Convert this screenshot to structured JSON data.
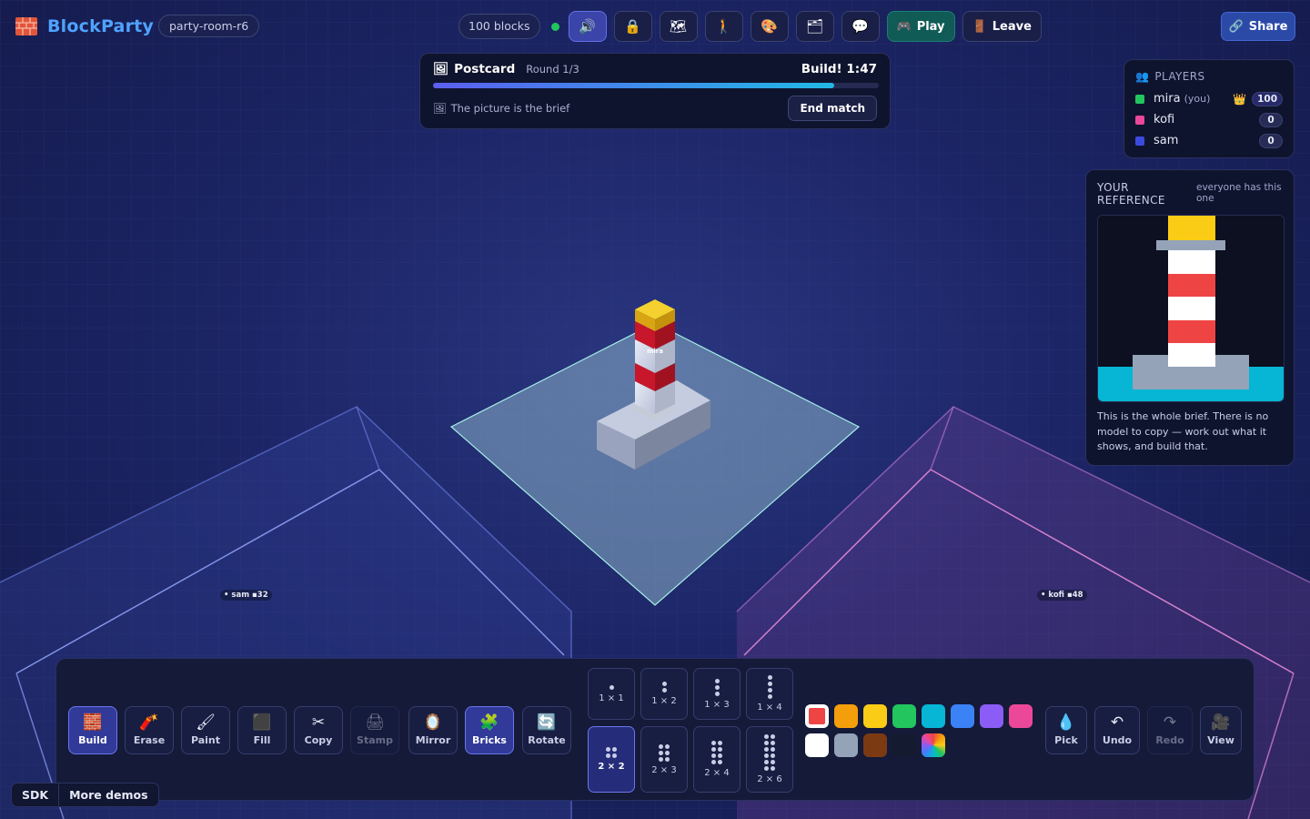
{
  "app": {
    "brand": "BlockParty",
    "room": "party-room-r6"
  },
  "topbar": {
    "blocks": "100 blocks",
    "buttons": [
      {
        "name": "sound-toggle-button",
        "icon": "🔊",
        "active": true
      },
      {
        "name": "lock-button",
        "icon": "🔒"
      },
      {
        "name": "map-button",
        "icon": "🗺"
      },
      {
        "name": "walk-button",
        "icon": "🚶"
      },
      {
        "name": "palette-button",
        "icon": "🎨"
      },
      {
        "name": "gallery-button",
        "icon": "🗂"
      },
      {
        "name": "chat-button",
        "icon": "💬"
      }
    ],
    "play_icon": "🎮",
    "play_label": "Play",
    "leave_icon": "🚪",
    "leave_label": "Leave",
    "share_icon": "🔗",
    "share_label": "Share"
  },
  "round": {
    "icon": "🖼",
    "title": "Postcard",
    "round_label": "Round 1/3",
    "timer": "Build! 1:47",
    "progress": 0.9,
    "hint_icon": "🖼",
    "hint": "The picture is the brief",
    "end_label": "End match"
  },
  "players": {
    "heading_icon": "👥",
    "heading": "PLAYERS",
    "list": [
      {
        "name": "mira",
        "you": "(you)",
        "crown": "👑",
        "score": "100",
        "color": "#22c55e"
      },
      {
        "name": "kofi",
        "score": "0",
        "color": "#ec4899"
      },
      {
        "name": "sam",
        "score": "0",
        "color": "#3b4be0"
      }
    ]
  },
  "reference": {
    "heading": "YOUR REFERENCE",
    "sub": "everyone has this one",
    "text": "This is the whole brief. There is no model to copy — work out what it shows, and build that."
  },
  "scene": {
    "tag_mira": "mira",
    "tag_sam": "sam",
    "tag_sam_count": "32",
    "tag_kofi": "kofi",
    "tag_kofi_count": "48"
  },
  "toolbar": {
    "tools": [
      {
        "name": "build-tool",
        "icon": "🧱",
        "label": "Build",
        "active": true
      },
      {
        "name": "erase-tool",
        "icon": "🧨",
        "label": "Erase"
      },
      {
        "name": "paint-tool",
        "icon": "🖌",
        "label": "Paint"
      },
      {
        "name": "fill-tool",
        "icon": "⬛",
        "label": "Fill"
      },
      {
        "name": "copy-tool",
        "icon": "✂",
        "label": "Copy"
      },
      {
        "name": "stamp-tool",
        "icon": "🖨",
        "label": "Stamp",
        "disabled": true
      },
      {
        "name": "mirror-tool",
        "icon": "🪞",
        "label": "Mirror"
      },
      {
        "name": "bricks-tool",
        "icon": "🧩",
        "label": "Bricks",
        "active": true
      },
      {
        "name": "rotate-tool",
        "icon": "🔄",
        "label": "Rotate"
      }
    ],
    "bricks": [
      {
        "label": "1 × 1",
        "cols": 1,
        "rows": 1
      },
      {
        "label": "1 × 2",
        "cols": 1,
        "rows": 2
      },
      {
        "label": "1 × 3",
        "cols": 1,
        "rows": 3
      },
      {
        "label": "1 × 4",
        "cols": 1,
        "rows": 4
      },
      {
        "label": "2 × 2",
        "cols": 2,
        "rows": 2,
        "selected": true
      },
      {
        "label": "2 × 3",
        "cols": 2,
        "rows": 3
      },
      {
        "label": "2 × 4",
        "cols": 2,
        "rows": 4
      },
      {
        "label": "2 × 6",
        "cols": 2,
        "rows": 6
      }
    ],
    "colors": [
      "#ef4444",
      "#f59e0b",
      "#facc15",
      "#22c55e",
      "#06b6d4",
      "#3b82f6",
      "#8b5cf6",
      "#ec4899",
      "#ffffff",
      "#94a3b8",
      "#7c3a12",
      "#141a30",
      "rainbow"
    ],
    "selected_color": "#ef4444",
    "actions": [
      {
        "name": "pick-button",
        "icon": "💧",
        "label": "Pick"
      },
      {
        "name": "undo-button",
        "icon": "↶",
        "label": "Undo"
      },
      {
        "name": "redo-button",
        "icon": "↷",
        "label": "Redo",
        "disabled": true
      },
      {
        "name": "view-button",
        "icon": "🎥",
        "label": "View"
      }
    ]
  },
  "footer": {
    "sdk": "SDK",
    "demos": "More demos"
  }
}
